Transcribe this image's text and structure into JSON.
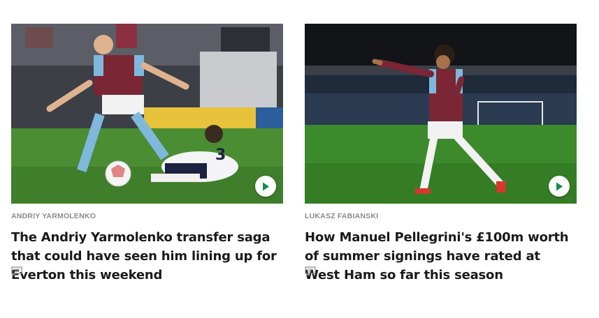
{
  "cards": [
    {
      "tag": "Andriy Yarmolenko",
      "headline": "The Andriy Yarmolenko transfer saga that could have seen him lining up for Everton this weekend",
      "image_icon": "video-play-icon",
      "comment_icon": "comment-icon"
    },
    {
      "tag": "Lukasz Fabianski",
      "headline": "How Manuel Pellegrini's £100m worth of summer signings have rated at West Ham so far this season",
      "image_icon": "video-play-icon",
      "comment_icon": "comment-icon"
    }
  ],
  "colors": {
    "accent": "#128c4b",
    "kicker": "#8a8a8a",
    "headline": "#1a1a1a",
    "claret": "#7a2634",
    "sky_blue": "#7fb8dc"
  }
}
